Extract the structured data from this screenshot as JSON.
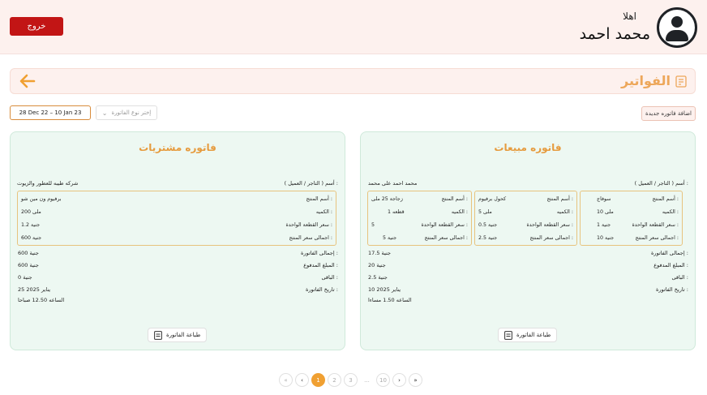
{
  "header": {
    "greeting": "اهلا",
    "user_name": "محمد احمد",
    "logout_label": "خروج"
  },
  "page": {
    "title": "الفواتير"
  },
  "toolbar": {
    "add_invoice_label": "اضافة فاتوره جديدة",
    "date_range": "28 Dec 22 – 10 Jan 23",
    "type_placeholder": "إختر نوع الفاتورة"
  },
  "sales_invoice": {
    "title": "فاتوره مبيعات",
    "client_label": "أسم ( التاجر / العميل ) :",
    "client_value": "محمد احمد على محمد",
    "items": [
      {
        "product_label": "أسم المنتج :",
        "product": "سوفاج",
        "qty_label": "الكميه :",
        "qty": "10 ملى",
        "unit_label": "سعر القطعة الواحدة :",
        "unit": "1 جنية",
        "total_label": "اجمالى سعر المنتج :",
        "total": "10 جنية"
      },
      {
        "product_label": "أسم المنتج :",
        "product": "كحول برفيوم",
        "qty_label": "الكميه :",
        "qty": "5 ملى",
        "unit_label": "سعر القطعة الواحدة :",
        "unit": "0.5 جنية",
        "total_label": "اجمالى سعر المنتج :",
        "total": "2.5 جنية"
      },
      {
        "product_label": "أسم المنتج :",
        "product": "زجاجة 25 ملى",
        "qty_label": "الكميه :",
        "qty": "1 قطعه",
        "unit_label": "سعر القطعة الواحدة :",
        "unit": "5",
        "total_label": "اجمالى سعر المنتج :",
        "total": "5 جنية"
      }
    ],
    "invoice_total_label": "إجمالى الفاتورة :",
    "invoice_total": "17.5 جنية",
    "paid_label": "المبلغ المدفوع :",
    "paid": "20 جنية",
    "remaining_label": "الباقى :",
    "remaining": "2.5 جنية",
    "date_label": "تاريخ الفاتورة :",
    "date": "10 يناير 2025",
    "time": "الساعه 1.50 مساءا",
    "print_label": "طباعة الفاتورة"
  },
  "purchase_invoice": {
    "title": "فاتوره مشتريات",
    "client_label": "أسم ( التاجر / العميل ) :",
    "client_value": "شركه طيبه للعطور والزيوت",
    "items": [
      {
        "product_label": "أسم المنتج :",
        "product": "برفيوم ون مين شو",
        "qty_label": "الكميه :",
        "qty": "200 ملى",
        "unit_label": "سعر القطعة الواحدة :",
        "unit": "1.2 جنية",
        "total_label": "اجمالى سعر المنتج :",
        "total": "600 جنية"
      }
    ],
    "invoice_total_label": "إجمالى الفاتورة :",
    "invoice_total": "600 جنية",
    "paid_label": "المبلغ المدفوع :",
    "paid": "600 جنية",
    "remaining_label": "الباقى :",
    "remaining": "0 جنية",
    "date_label": "تاريخ الفاتورة :",
    "date": "25 يناير 2025",
    "time": "الساعه 12.50 صباحا",
    "print_label": "طباعة الفاتورة"
  },
  "pagination": {
    "first": "«",
    "prev": "‹",
    "pages": [
      "1",
      "2",
      "3",
      "...",
      "10"
    ],
    "current": "1",
    "next": "›",
    "last": "»"
  },
  "colors": {
    "accent": "#f0a032",
    "logout": "#c21515",
    "header_bg": "#fdf1ee",
    "card_bg": "#edf8f2",
    "title_orange": "#e69b3e"
  }
}
